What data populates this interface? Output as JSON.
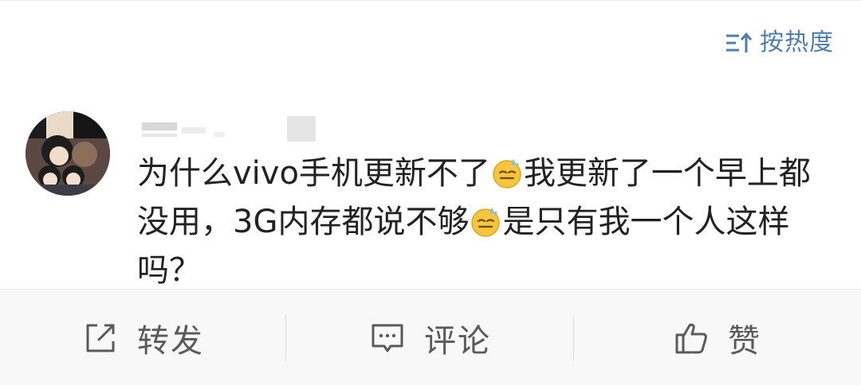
{
  "sort": {
    "label": "按热度",
    "icon": "sort-desc-icon"
  },
  "comment": {
    "avatar_icon": "avatar",
    "username": "",
    "text_part1": "为什么vivo手机更新不了",
    "emoji1": "sweat-smile-emoji",
    "text_part2": "我更新了一个早上都没用，3G内存都说不够",
    "emoji2": "sweat-smile-emoji",
    "text_part3": "是只有我一个人这样吗？"
  },
  "actions": {
    "repost": {
      "label": "转发",
      "icon": "share-icon"
    },
    "comment": {
      "label": "评论",
      "icon": "comment-icon"
    },
    "like": {
      "label": "赞",
      "icon": "thumbs-up-icon"
    }
  },
  "colors": {
    "link": "#507daf",
    "text": "#222222",
    "action_text": "#5a5a5a",
    "action_bg": "#f8f8f8"
  }
}
